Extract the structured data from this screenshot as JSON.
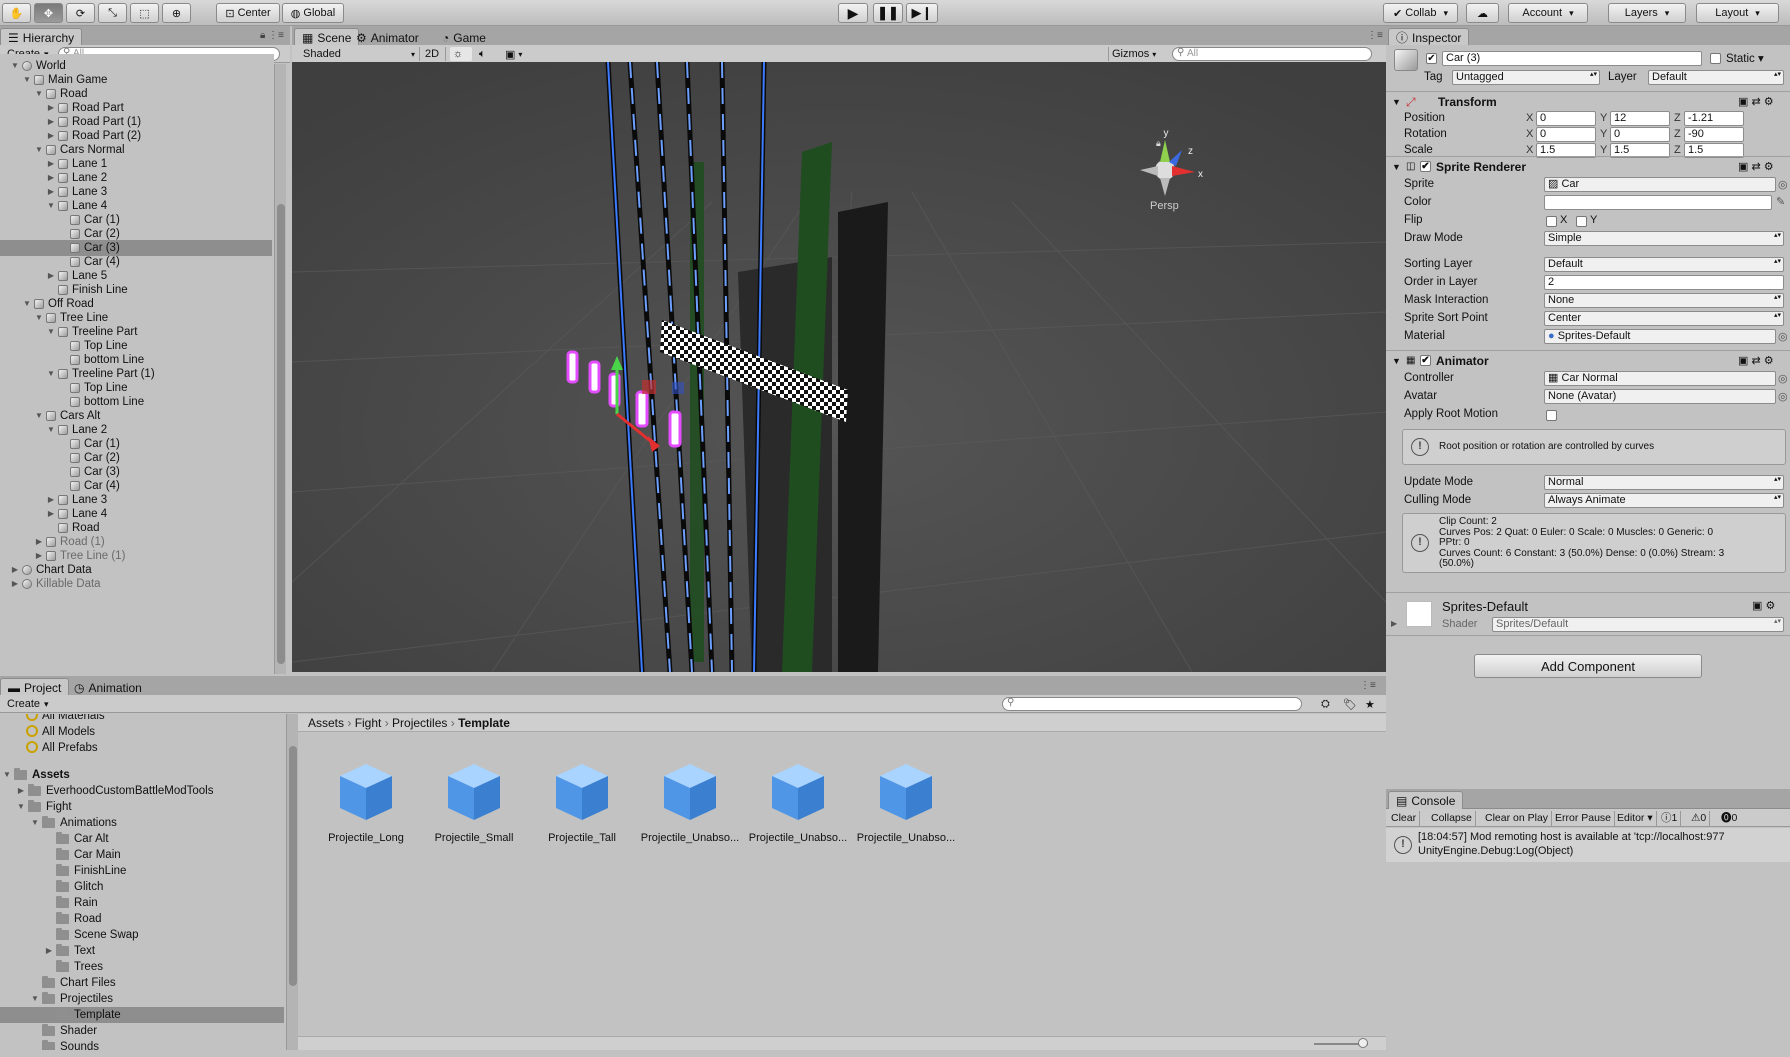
{
  "toolbar": {
    "tools": [
      {
        "icon": "hand-icon",
        "glyph": "✋"
      },
      {
        "icon": "move-icon",
        "glyph": "✥"
      },
      {
        "icon": "rotate-icon",
        "glyph": "⟳"
      },
      {
        "icon": "scale-icon",
        "glyph": "⤡"
      },
      {
        "icon": "rect-icon",
        "glyph": "⬚"
      },
      {
        "icon": "transform-icon",
        "glyph": "⊕"
      }
    ],
    "pivot": "Center",
    "space": "Global",
    "collab": "Collab",
    "account": "Account",
    "layers": "Layers",
    "layout": "Layout"
  },
  "hierarchy": {
    "tab": "Hierarchy",
    "create": "Create",
    "search_placeholder": "All",
    "rows": [
      {
        "label": "World",
        "depth": 0,
        "arrow": "open",
        "icon": "unity"
      },
      {
        "label": "Main Game",
        "depth": 1,
        "arrow": "open"
      },
      {
        "label": "Road",
        "depth": 2,
        "arrow": "open"
      },
      {
        "label": "Road Part",
        "depth": 3,
        "arrow": "closed"
      },
      {
        "label": "Road Part (1)",
        "depth": 3,
        "arrow": "closed"
      },
      {
        "label": "Road Part (2)",
        "depth": 3,
        "arrow": "closed"
      },
      {
        "label": "Cars Normal",
        "depth": 2,
        "arrow": "open"
      },
      {
        "label": "Lane 1",
        "depth": 3,
        "arrow": "closed"
      },
      {
        "label": "Lane 2",
        "depth": 3,
        "arrow": "closed"
      },
      {
        "label": "Lane 3",
        "depth": 3,
        "arrow": "closed"
      },
      {
        "label": "Lane 4",
        "depth": 3,
        "arrow": "open"
      },
      {
        "label": "Car (1)",
        "depth": 4,
        "arrow": "none"
      },
      {
        "label": "Car (2)",
        "depth": 4,
        "arrow": "none"
      },
      {
        "label": "Car (3)",
        "depth": 4,
        "arrow": "none",
        "selected": true
      },
      {
        "label": "Car (4)",
        "depth": 4,
        "arrow": "none"
      },
      {
        "label": "Lane 5",
        "depth": 3,
        "arrow": "closed"
      },
      {
        "label": "Finish Line",
        "depth": 3,
        "arrow": "none"
      },
      {
        "label": "Off Road",
        "depth": 1,
        "arrow": "open"
      },
      {
        "label": "Tree Line",
        "depth": 2,
        "arrow": "open"
      },
      {
        "label": "Treeline Part",
        "depth": 3,
        "arrow": "open"
      },
      {
        "label": "Top Line",
        "depth": 4,
        "arrow": "none"
      },
      {
        "label": "bottom Line",
        "depth": 4,
        "arrow": "none"
      },
      {
        "label": "Treeline Part (1)",
        "depth": 3,
        "arrow": "open"
      },
      {
        "label": "Top Line",
        "depth": 4,
        "arrow": "none"
      },
      {
        "label": "bottom Line",
        "depth": 4,
        "arrow": "none"
      },
      {
        "label": "Cars Alt",
        "depth": 2,
        "arrow": "open"
      },
      {
        "label": "Lane 2",
        "depth": 3,
        "arrow": "open"
      },
      {
        "label": "Car (1)",
        "depth": 4,
        "arrow": "none"
      },
      {
        "label": "Car (2)",
        "depth": 4,
        "arrow": "none"
      },
      {
        "label": "Car (3)",
        "depth": 4,
        "arrow": "none"
      },
      {
        "label": "Car (4)",
        "depth": 4,
        "arrow": "none"
      },
      {
        "label": "Lane 3",
        "depth": 3,
        "arrow": "closed"
      },
      {
        "label": "Lane 4",
        "depth": 3,
        "arrow": "closed"
      },
      {
        "label": "Road",
        "depth": 3,
        "arrow": "none"
      },
      {
        "label": "Road (1)",
        "depth": 2,
        "arrow": "closed",
        "dim": true
      },
      {
        "label": "Tree Line (1)",
        "depth": 2,
        "arrow": "closed",
        "dim": true
      },
      {
        "label": "Chart Data",
        "depth": 0,
        "arrow": "closed",
        "icon": "unity"
      },
      {
        "label": "Killable Data",
        "depth": 0,
        "arrow": "closed",
        "icon": "unity",
        "dim": true
      }
    ]
  },
  "scene": {
    "tabs": [
      "Scene",
      "Animator",
      "Game"
    ],
    "shading": "Shaded",
    "mode2d": "2D",
    "gizmos": "Gizmos",
    "search_placeholder": "All",
    "persp": "Persp",
    "gizmo_axes": {
      "y": "y",
      "z": "z",
      "x": "x"
    }
  },
  "inspector": {
    "tab": "Inspector",
    "object_name": "Car (3)",
    "static_label": "Static",
    "tag_label": "Tag",
    "tag": "Untagged",
    "layer_label": "Layer",
    "layer": "Default",
    "transform": {
      "title": "Transform",
      "rows": [
        {
          "label": "Position",
          "x": "0",
          "y": "12",
          "z": "-1.21"
        },
        {
          "label": "Rotation",
          "x": "0",
          "y": "0",
          "z": "-90"
        },
        {
          "label": "Scale",
          "x": "1.5",
          "y": "1.5",
          "z": "1.5"
        }
      ],
      "axes": [
        "X",
        "Y",
        "Z"
      ]
    },
    "sprite_renderer": {
      "title": "Sprite Renderer",
      "sprite_label": "Sprite",
      "sprite": "Car",
      "color_label": "Color",
      "flip_label": "Flip",
      "flip_x": "X",
      "flip_y": "Y",
      "draw_mode_label": "Draw Mode",
      "draw_mode": "Simple",
      "sorting_layer_label": "Sorting Layer",
      "sorting_layer": "Default",
      "order_label": "Order in Layer",
      "order": "2",
      "mask_label": "Mask Interaction",
      "mask": "None",
      "sort_point_label": "Sprite Sort Point",
      "sort_point": "Center",
      "material_label": "Material",
      "material": "Sprites-Default"
    },
    "animator": {
      "title": "Animator",
      "controller_label": "Controller",
      "controller": "Car Normal",
      "avatar_label": "Avatar",
      "avatar": "None (Avatar)",
      "root_motion_label": "Apply Root Motion",
      "root_motion_note": "Root position or rotation are controlled by curves",
      "update_label": "Update Mode",
      "update": "Normal",
      "culling_label": "Culling Mode",
      "culling": "Always Animate",
      "info_lines": [
        "Clip Count: 2",
        "Curves Pos: 2 Quat: 0 Euler: 0 Scale: 0 Muscles: 0 Generic: 0",
        "PPtr: 0",
        "Curves Count: 6 Constant: 3 (50.0%) Dense: 0 (0.0%) Stream: 3",
        "(50.0%)"
      ]
    },
    "material": {
      "name": "Sprites-Default",
      "shader_label": "Shader",
      "shader": "Sprites/Default"
    },
    "add_component": "Add Component"
  },
  "project": {
    "tabs": [
      "Project",
      "Animation"
    ],
    "create": "Create",
    "favorites": [
      "All Materials",
      "All Models",
      "All Prefabs"
    ],
    "tree": [
      {
        "label": "Assets",
        "depth": 0,
        "arrow": "open",
        "bold": true
      },
      {
        "label": "EverhoodCustomBattleModTools",
        "depth": 1,
        "arrow": "closed"
      },
      {
        "label": "Fight",
        "depth": 1,
        "arrow": "open"
      },
      {
        "label": "Animations",
        "depth": 2,
        "arrow": "open"
      },
      {
        "label": "Car Alt",
        "depth": 3,
        "arrow": "none"
      },
      {
        "label": "Car Main",
        "depth": 3,
        "arrow": "none"
      },
      {
        "label": "FinishLine",
        "depth": 3,
        "arrow": "none"
      },
      {
        "label": "Glitch",
        "depth": 3,
        "arrow": "none"
      },
      {
        "label": "Rain",
        "depth": 3,
        "arrow": "none"
      },
      {
        "label": "Road",
        "depth": 3,
        "arrow": "none"
      },
      {
        "label": "Scene Swap",
        "depth": 3,
        "arrow": "none"
      },
      {
        "label": "Text",
        "depth": 3,
        "arrow": "closed"
      },
      {
        "label": "Trees",
        "depth": 3,
        "arrow": "none"
      },
      {
        "label": "Chart Files",
        "depth": 2,
        "arrow": "none"
      },
      {
        "label": "Projectiles",
        "depth": 2,
        "arrow": "open"
      },
      {
        "label": "Template",
        "depth": 3,
        "arrow": "none",
        "selected": true
      },
      {
        "label": "Shader",
        "depth": 2,
        "arrow": "none"
      },
      {
        "label": "Sounds",
        "depth": 2,
        "arrow": "none"
      }
    ],
    "breadcrumb": [
      "Assets",
      "Fight",
      "Projectiles",
      "Template"
    ],
    "assets": [
      "Projectile_Long",
      "Projectile_Small",
      "Projectile_Tall",
      "Projectile_Unabso...",
      "Projectile_Unabso...",
      "Projectile_Unabso..."
    ]
  },
  "console": {
    "tab": "Console",
    "buttons": [
      "Clear",
      "Collapse",
      "Clear on Play",
      "Error Pause",
      "Editor"
    ],
    "counts": {
      "info": "1",
      "warn": "0",
      "error": "0"
    },
    "message_line1": "[18:04:57] Mod remoting host is available at 'tcp://localhost:977",
    "message_line2": "UnityEngine.Debug:Log(Object)"
  },
  "colors": {
    "selection": "#8e8e8e",
    "panel": "#c2c2c2",
    "scene_bg": "#484848",
    "lane_blue": "#2a6cff",
    "tree_green": "#1f4d1f"
  }
}
